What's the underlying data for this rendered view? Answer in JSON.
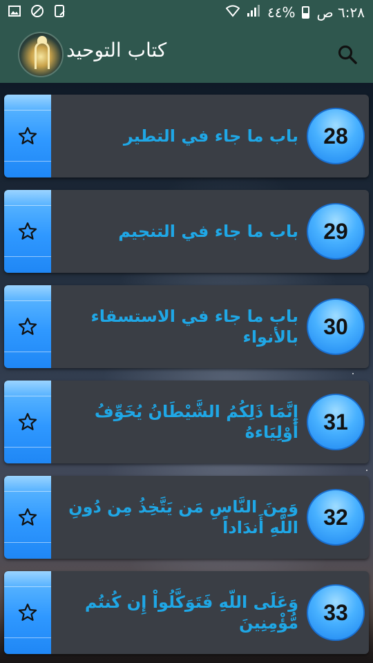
{
  "status_bar": {
    "time": "٦:٢٨ ص",
    "battery": "%٤٤",
    "icons": [
      "signal-icon",
      "wifi-icon",
      "battery-icon",
      "notification-icon",
      "vpn-shield-icon",
      "image-icon"
    ]
  },
  "app_bar": {
    "title": "كتاب التوحيد",
    "logo": "mosque-logo",
    "search_icon": "search-icon"
  },
  "chapters": [
    {
      "number": "28",
      "title": "باب ما جاء في التطير"
    },
    {
      "number": "29",
      "title": "باب ما جاء في التنجيم"
    },
    {
      "number": "30",
      "title": "باب ما جاء في الاستسقاء بالأنواء"
    },
    {
      "number": "31",
      "title": "إِنَّمَا ذَلِكُمُ الشَّيْطَانُ يُخَوِّفُ أَوْلِيَاءهُ"
    },
    {
      "number": "32",
      "title": "وَمِنَ النَّاسِ مَن يَتَّخِذُ مِن دُونِ اللّهِ أَندَاداً"
    },
    {
      "number": "33",
      "title": "وَعَلَى اللّهِ فَتَوَكَّلُواْ إِن كُنتُم مُّؤْمِنِينَ"
    }
  ],
  "colors": {
    "app_bar": "#2f574e",
    "card": "#3a3e45",
    "title_text": "#1fa7e6",
    "accent_blue": "#2f98ff"
  }
}
